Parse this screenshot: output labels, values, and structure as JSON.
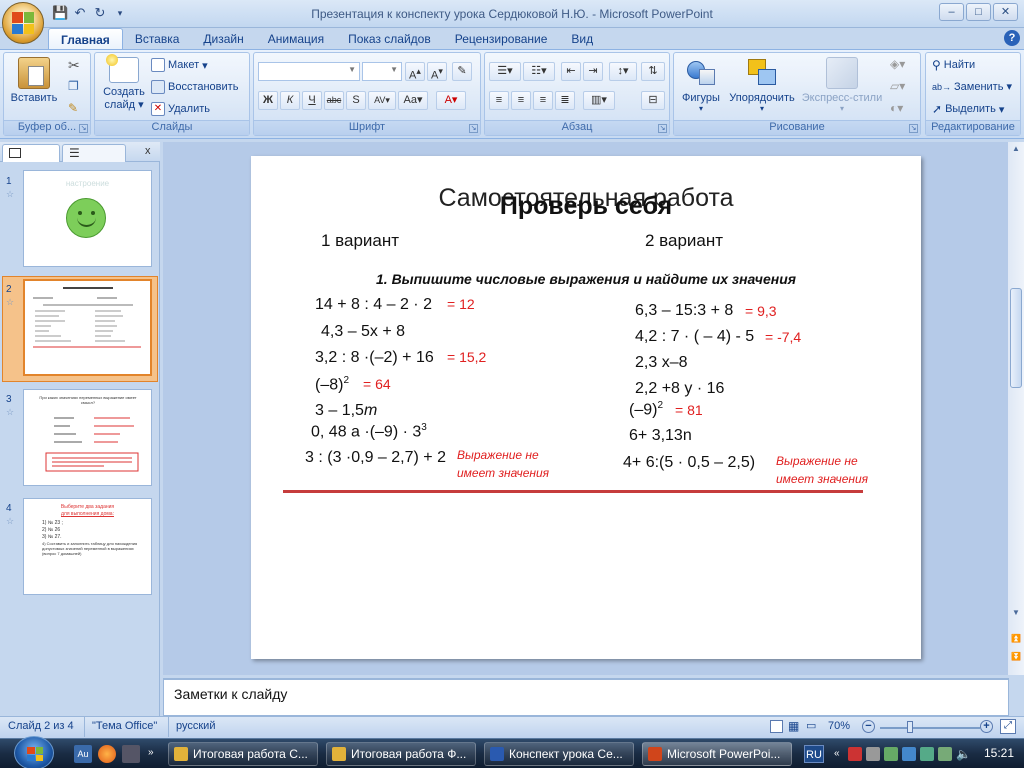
{
  "window": {
    "title": "Презентация к конспекту урока Сердюковой Н.Ю. - Microsoft PowerPoint",
    "min": "–",
    "max": "□",
    "close": "✕"
  },
  "tabs": [
    "Главная",
    "Вставка",
    "Дизайн",
    "Анимация",
    "Показ слайдов",
    "Рецензирование",
    "Вид"
  ],
  "ribbon": {
    "clipboard": {
      "label": "Буфер об...",
      "paste": "Вставить"
    },
    "slides": {
      "label": "Слайды",
      "create": "Создать",
      "create2": "слайд",
      "layout": "Макет",
      "reset": "Восстановить",
      "delete": "Удалить"
    },
    "font": {
      "label": "Шрифт"
    },
    "paragraph": {
      "label": "Абзац"
    },
    "drawing": {
      "label": "Рисование",
      "shapes": "Фигуры",
      "arrange": "Упорядочить",
      "styles": "Экспресс-стили"
    },
    "editing": {
      "label": "Редактирование",
      "find": "Найти",
      "replace": "Заменить",
      "select": "Выделить"
    }
  },
  "thumbnails": [
    {
      "num": "1",
      "title": "настроение"
    },
    {
      "num": "2"
    },
    {
      "num": "3",
      "text1": "При каких значениях переменных выражение имеет смысл?"
    },
    {
      "num": "4",
      "t1": "Выберите два задания",
      "t2": "для выполнения дома:",
      "l1": "1) № 23 ;",
      "l2": "2) № 26",
      "l3": "3) № 27.",
      "l4": "4) Составить и заполнить таблицу для нахождения допустимых значений переменной в выражениях (вопрос 7 домашней)"
    }
  ],
  "slide": {
    "title_bg": "Самостоятельная работа",
    "title_fg": "Проверь себя",
    "v1": "1 вариант",
    "v2": "2 вариант",
    "task": "1. Выпишите числовые выражения и найдите их значения",
    "left": [
      {
        "expr": "14 + 8 : 4 – 2 · 2",
        "ans": "= 12"
      },
      {
        "expr": "4,3 – 5x + 8",
        "ans": ""
      },
      {
        "expr": "3,2 : 8 ·(–2) + 16",
        "ans": "= 15,2"
      },
      {
        "expr": "(–8)",
        "sup": "2",
        "ans": "= 64"
      },
      {
        "expr": "3 – 1,5",
        "var": "m",
        "ans": ""
      },
      {
        "expr": "0, 48 a ·(–9) · 3",
        "sup": "3",
        "ans": ""
      },
      {
        "expr": "3 : (3 ·0,9 – 2,7) + 2",
        "ans": ""
      }
    ],
    "right": [
      {
        "expr": "6,3 – 15:3 + 8",
        "ans": "= 9,3"
      },
      {
        "expr": "4,2 : 7 · ( – 4) - 5",
        "ans": "= -7,4"
      },
      {
        "expr": "2,3 x–8",
        "ans": ""
      },
      {
        "expr": "2,2 +8 y  · 16",
        "ans": ""
      },
      {
        "expr": "(–9)",
        "sup": "2",
        "ans": "= 81"
      },
      {
        "expr": "6+ 3,13n",
        "ans": ""
      },
      {
        "expr": "4+ 6:(5  · 0,5 – 2,5)",
        "ans": ""
      }
    ],
    "no_value_1a": "Выражение не",
    "no_value_1b": "имеет значения",
    "no_value_2a": "Выражение не",
    "no_value_2b": "имеет значения"
  },
  "notes_placeholder": "Заметки к слайду",
  "status": {
    "slide": "Слайд 2 из 4",
    "theme": "\"Тема Office\"",
    "lang": "русский",
    "zoom": "70%"
  },
  "taskbar": {
    "items": [
      "Итоговая работа С...",
      "Итоговая работа Ф...",
      "Конспект урока Се...",
      "Microsoft PowerPoi..."
    ],
    "lang": "RU",
    "time": "15:21"
  }
}
